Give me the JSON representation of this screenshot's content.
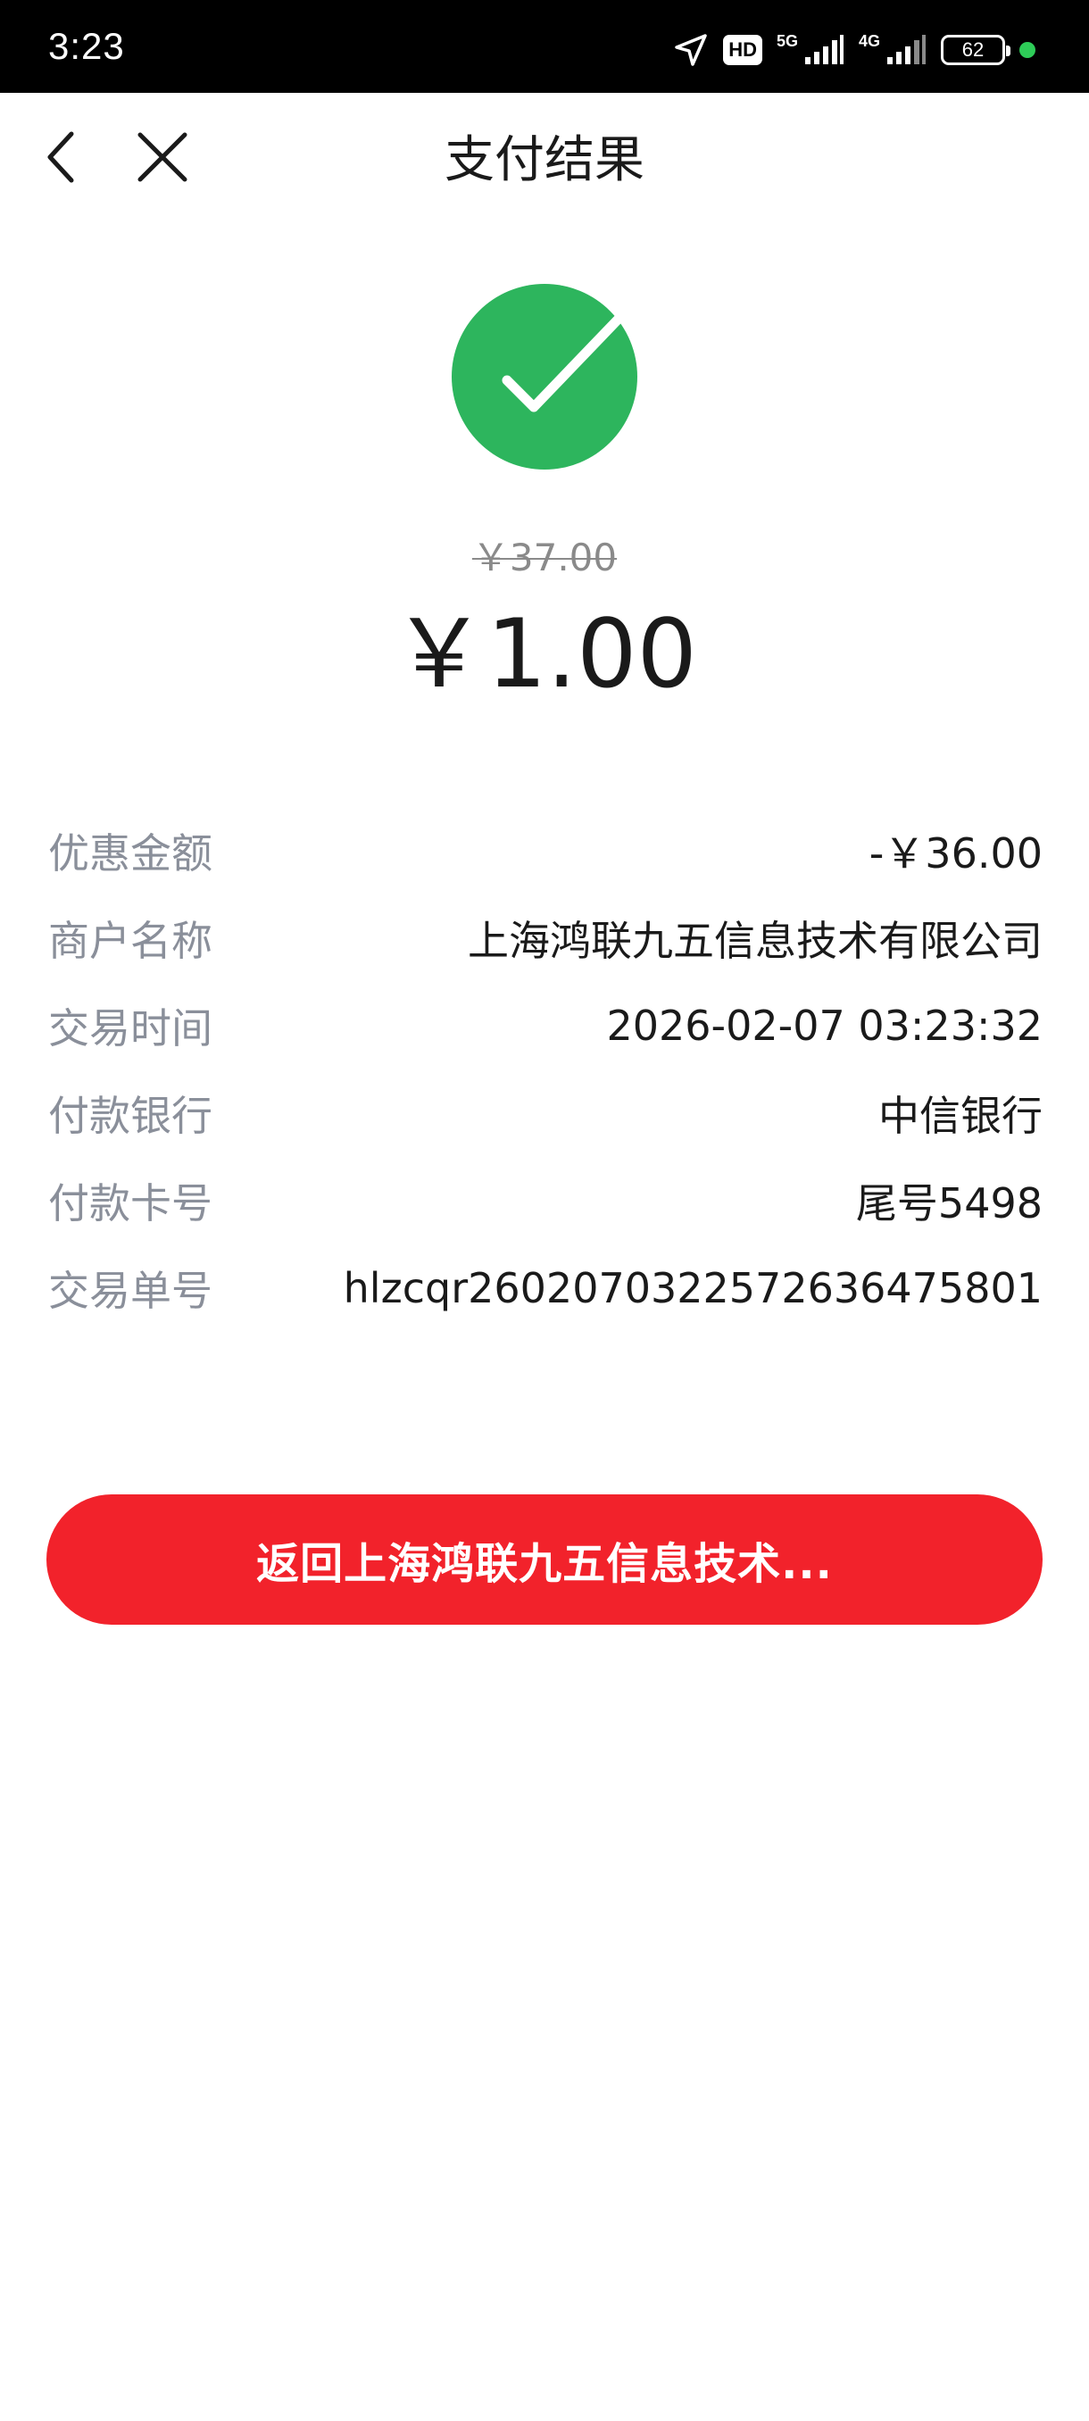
{
  "status_bar": {
    "time": "3:23",
    "hd_label": "HD",
    "network_5g": "5G",
    "network_4g": "4G",
    "battery_level": "62"
  },
  "nav": {
    "title": "支付结果"
  },
  "payment": {
    "original_price": "￥37.00",
    "paid_amount": "￥1.00"
  },
  "details": [
    {
      "label": "优惠金额",
      "value": "-￥36.00"
    },
    {
      "label": "商户名称",
      "value": "上海鸿联九五信息技术有限公司"
    },
    {
      "label": "交易时间",
      "value": "2026-02-07 03:23:32"
    },
    {
      "label": "付款银行",
      "value": "中信银行"
    },
    {
      "label": "付款卡号",
      "value": "尾号5498"
    },
    {
      "label": "交易单号",
      "value": "hlzcqr26020703225726364758​01"
    }
  ],
  "return_button": {
    "label": "返回上海鸿联九五信息技术..."
  },
  "colors": {
    "success_green": "#2db55d",
    "button_red": "#f2222b",
    "label_gray": "#8a8f9a"
  },
  "icons": {
    "back": "chevron-left-icon",
    "close": "close-icon",
    "success": "checkmark-circle-icon",
    "location": "navigation-arrow-icon",
    "signal": "signal-bars-icon",
    "battery": "battery-icon"
  }
}
